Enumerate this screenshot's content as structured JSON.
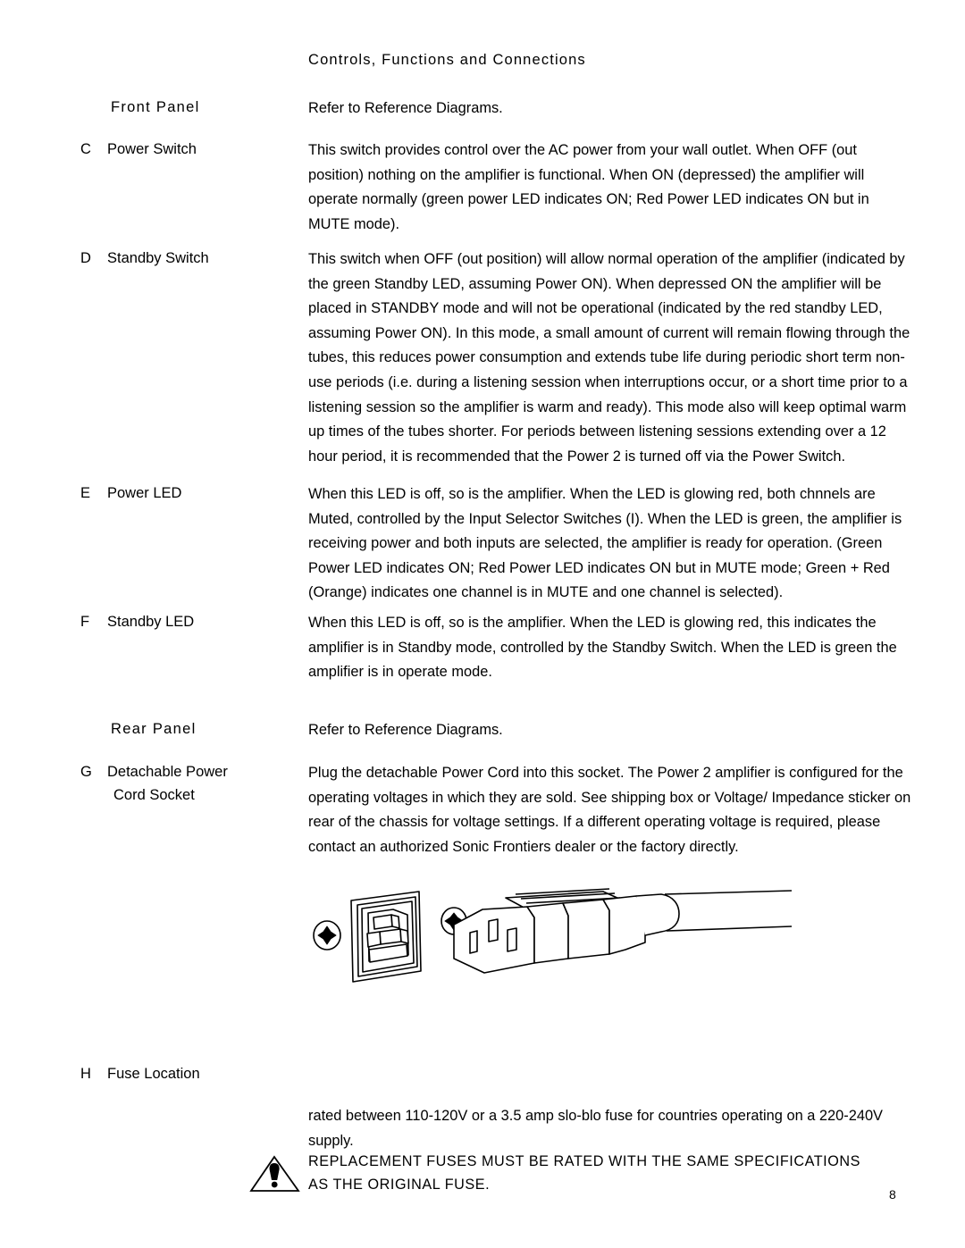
{
  "document": {
    "title": "Controls, Functions and Connections",
    "page_number": "8"
  },
  "sections": [
    {
      "heading": "Front Panel",
      "body": "Refer to Reference Diagrams."
    },
    {
      "heading": "Rear Panel",
      "body": "Refer to Reference Diagrams."
    }
  ],
  "entries": [
    {
      "letter": "C",
      "label": "Power Switch",
      "label_second_line": "",
      "body": "This switch provides control over the AC power from your wall outlet. When OFF (out position) nothing on the amplifier is functional. When ON (depressed) the amplifier will operate normally (green power LED indicates ON; Red Power LED indicates ON but in MUTE mode)."
    },
    {
      "letter": "D",
      "label": "Standby Switch",
      "label_second_line": "",
      "body": "This switch when OFF (out position) will allow normal operation of the amplifier (indicated by the green Standby LED, assuming Power ON). When depressed ON the amplifier will be placed in STANDBY mode and will not be operational (indicated by the red standby LED, assuming Power ON). In this mode, a small amount of current will remain flowing through the tubes, this reduces power consumption and extends tube life during periodic short term non-use periods (i.e. during a listening session when interruptions occur, or a short time prior to a listening session so the amplifier is warm and ready). This mode also will keep optimal warm up times of the tubes shorter. For periods between listening sessions extending over a 12 hour period, it is recommended that the Power 2 is turned off via the Power Switch."
    },
    {
      "letter": "E",
      "label": "Power LED",
      "label_second_line": "",
      "body": "When this LED is off, so is the amplifier. When the LED is glowing red, both chnnels are Muted, controlled by the Input Selector Switches (I). When the LED is green, the amplifier is receiving power and both inputs are selected, the amplifier is ready for operation. (Green Power LED indicates ON; Red Power LED indicates ON but in MUTE mode; Green + Red (Orange) indicates one channel is in MUTE and one channel is selected)."
    },
    {
      "letter": "F",
      "label": "Standby LED",
      "label_second_line": "",
      "body": "When this LED is off, so is the amplifier. When the LED is glowing red, this indicates the amplifier is in Standby mode, controlled by the Standby Switch. When the LED is green the amplifier is in operate mode."
    },
    {
      "letter": "G",
      "label": "Detachable Power",
      "label_second_line": "Cord Socket",
      "body": "Plug the detachable Power Cord into this socket. The Power 2 amplifier is configured for the operating voltages in which they are sold. See shipping box or Voltage/ Impedance sticker on rear of the chassis for voltage settings. If a different operating voltage is required, please contact an authorized Sonic Frontiers dealer or the factory directly."
    },
    {
      "letter": "H",
      "label": "Fuse Location",
      "label_second_line": "",
      "body": "rated between 110-120V or a 3.5 amp slo-blo fuse for countries operating on a 220-240V supply."
    }
  ],
  "diagram": {
    "caption_icons": [
      "screw-icon",
      "iec-inlet-socket-icon",
      "screw-icon",
      "iec-power-cord-connector-icon"
    ]
  },
  "warning": {
    "icon": "warning-triangle-icon",
    "line1": "REPLACEMENT FUSES MUST BE RATED WITH THE SAME SPECIFICATIONS",
    "line2": "AS THE ORIGINAL FUSE."
  }
}
